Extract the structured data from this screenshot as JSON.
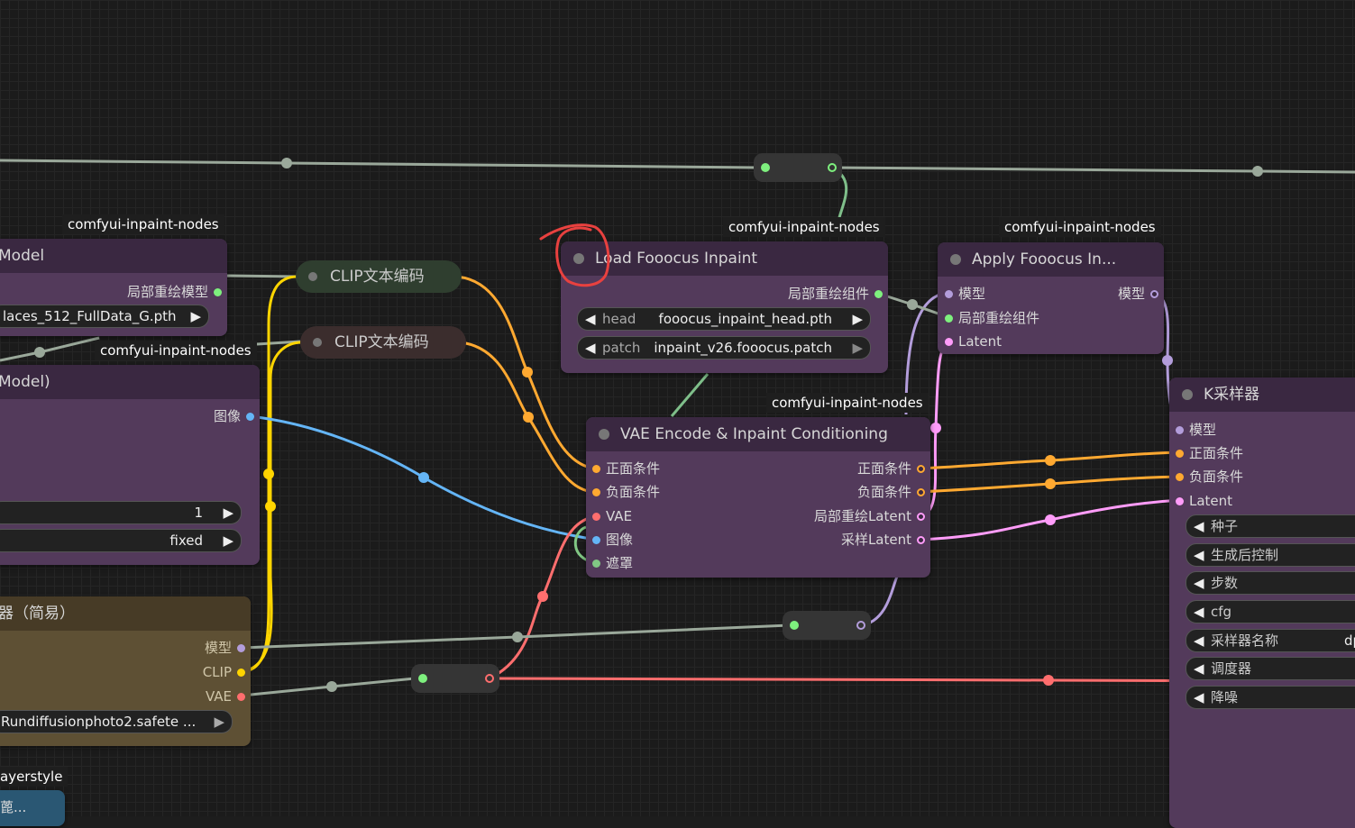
{
  "colors": {
    "model": "#b39ddb",
    "clip": "#ffd500",
    "vae": "#ff6e6e",
    "image": "#64b5f6",
    "mask": "#81c784",
    "conditioning": "#ffa931",
    "latent": "#ff9cf9",
    "inpaint": "#7ef07e",
    "node_purple": "#533a5b",
    "node_brown": "#5e5034",
    "wire_grey": "#9aa89a"
  },
  "top_left_node": {
    "tag": "comfyui-inpaint-nodes",
    "title": "Model",
    "output_label": "局部重绘模型",
    "widget_value": "laces_512_FullData_G.pth"
  },
  "left_node_2": {
    "tag": "comfyui-inpaint-nodes",
    "title": "Model)",
    "output_label": "图像",
    "widget1_value": "1",
    "widget2_value": "fixed"
  },
  "clip_nodes": [
    {
      "title": "CLIP文本编码"
    },
    {
      "title": "CLIP文本编码"
    }
  ],
  "loader_node": {
    "title": "器（简易）",
    "outputs": [
      "模型",
      "CLIP",
      "VAE"
    ],
    "widget_value": "Rundiffusionphoto2.safete ..."
  },
  "bottom_tag": "ayerstyle",
  "bottom_node_text": "蓖...",
  "load_fooocus": {
    "tag": "comfyui-inpaint-nodes",
    "title": "Load Fooocus Inpaint",
    "output_label": "局部重绘组件",
    "head_label": "head",
    "head_value": "fooocus_inpaint_head.pth",
    "patch_label": "patch",
    "patch_value": "inpaint_v26.fooocus.patch"
  },
  "apply_fooocus": {
    "tag": "comfyui-inpaint-nodes",
    "title": "Apply Fooocus In...",
    "inputs": [
      "模型",
      "局部重绘组件",
      "Latent"
    ],
    "output_label": "模型"
  },
  "vae_encode": {
    "tag": "comfyui-inpaint-nodes",
    "title": "VAE Encode & Inpaint Conditioning",
    "inputs": [
      "正面条件",
      "负面条件",
      "VAE",
      "图像",
      "遮罩"
    ],
    "outputs": [
      "正面条件",
      "负面条件",
      "局部重绘Latent",
      "采样Latent"
    ]
  },
  "ksampler": {
    "title": "K采样器",
    "inputs": [
      "模型",
      "正面条件",
      "负面条件",
      "Latent"
    ],
    "widgets": [
      "种子",
      "生成后控制",
      "步数",
      "cfg",
      "采样器名称",
      "调度器",
      "降噪"
    ],
    "sampler_value_partial": "dp"
  }
}
